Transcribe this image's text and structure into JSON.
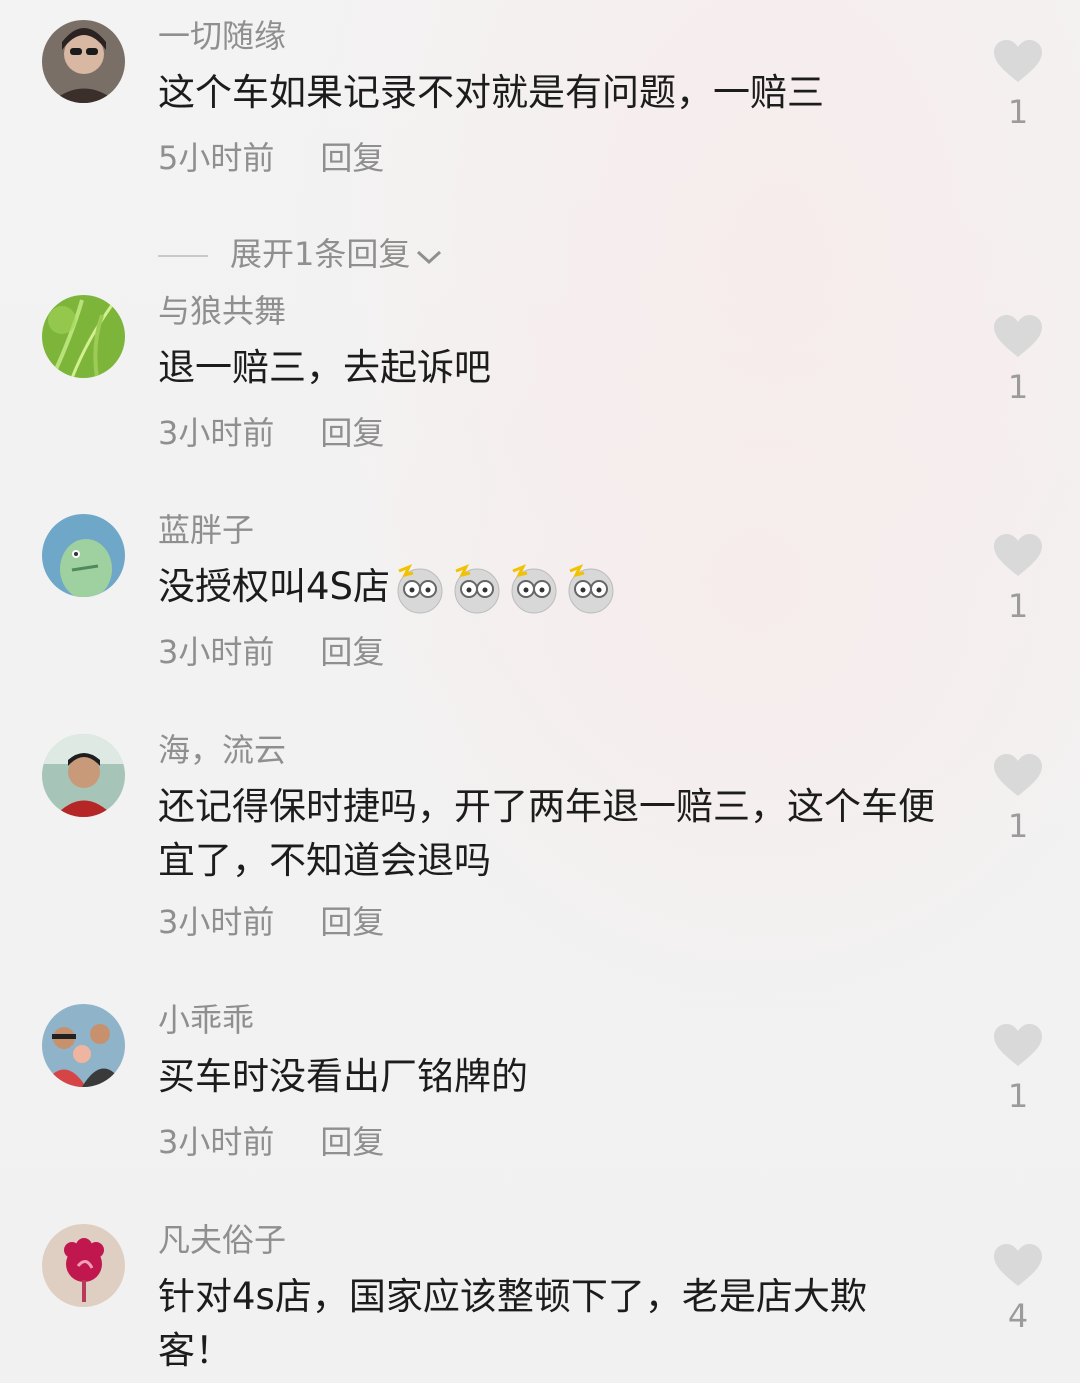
{
  "comments": [
    {
      "username": "一切随缘",
      "text": "这个车如果记录不对就是有问题，一赔三",
      "time": "5小时前",
      "reply": "回复",
      "likes": "1",
      "expand": "展开1条回复"
    },
    {
      "username": "与狼共舞",
      "text": "退一赔三，去起诉吧",
      "time": "3小时前",
      "reply": "回复",
      "likes": "1"
    },
    {
      "username": "蓝胖子",
      "text": "没授权叫4S店",
      "time": "3小时前",
      "reply": "回复",
      "likes": "1",
      "emoji_count": 4
    },
    {
      "username": "海，流云",
      "text": "还记得保时捷吗，开了两年退一赔三，这个车便宜了，不知道会退吗",
      "time": "3小时前",
      "reply": "回复",
      "likes": "1"
    },
    {
      "username": "小乖乖",
      "text": "买车时没看出厂铭牌的",
      "time": "3小时前",
      "reply": "回复",
      "likes": "1"
    },
    {
      "username": "凡夫俗子",
      "text": "针对4s店，国家应该整顿下了，老是店大欺客！",
      "likes": "4"
    }
  ],
  "colors": {
    "username": "#8f8f8f",
    "text": "#1c1c1c",
    "heart": "#d9d9d9"
  }
}
